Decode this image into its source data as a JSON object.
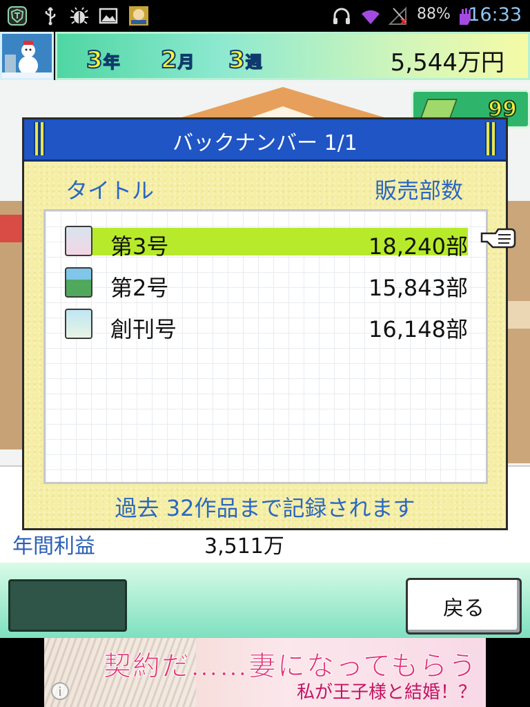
{
  "status_bar": {
    "battery_text": "88%",
    "clock": "16:33"
  },
  "header": {
    "year_num": "3",
    "year_unit": "年",
    "month_num": "2",
    "month_unit": "月",
    "week_num": "3",
    "week_unit": "週",
    "money": "5,544万円",
    "sign_value": "99"
  },
  "dialog": {
    "title": "バックナンバー 1/1",
    "col_title": "タイトル",
    "col_sales": "販売部数",
    "rows": [
      {
        "title": "第3号",
        "sales": "18,240部",
        "selected": true
      },
      {
        "title": "第2号",
        "sales": "15,843部",
        "selected": false
      },
      {
        "title": "創刊号",
        "sales": "16,148部",
        "selected": false
      }
    ],
    "note": "過去 32作品まで記録されます"
  },
  "background_stats": {
    "row2_label": "年間利益",
    "row2_value": "3,511万"
  },
  "bottom": {
    "back_label": "戻る"
  },
  "ad": {
    "headline": "契約だ……妻になってもらう",
    "subline": "私が王子様と結婚！？",
    "info": "i"
  },
  "colors": {
    "dialog_title_bg": "#1f55c4",
    "selected_row": "#b7ea2a",
    "label_blue": "#2a67c3"
  }
}
